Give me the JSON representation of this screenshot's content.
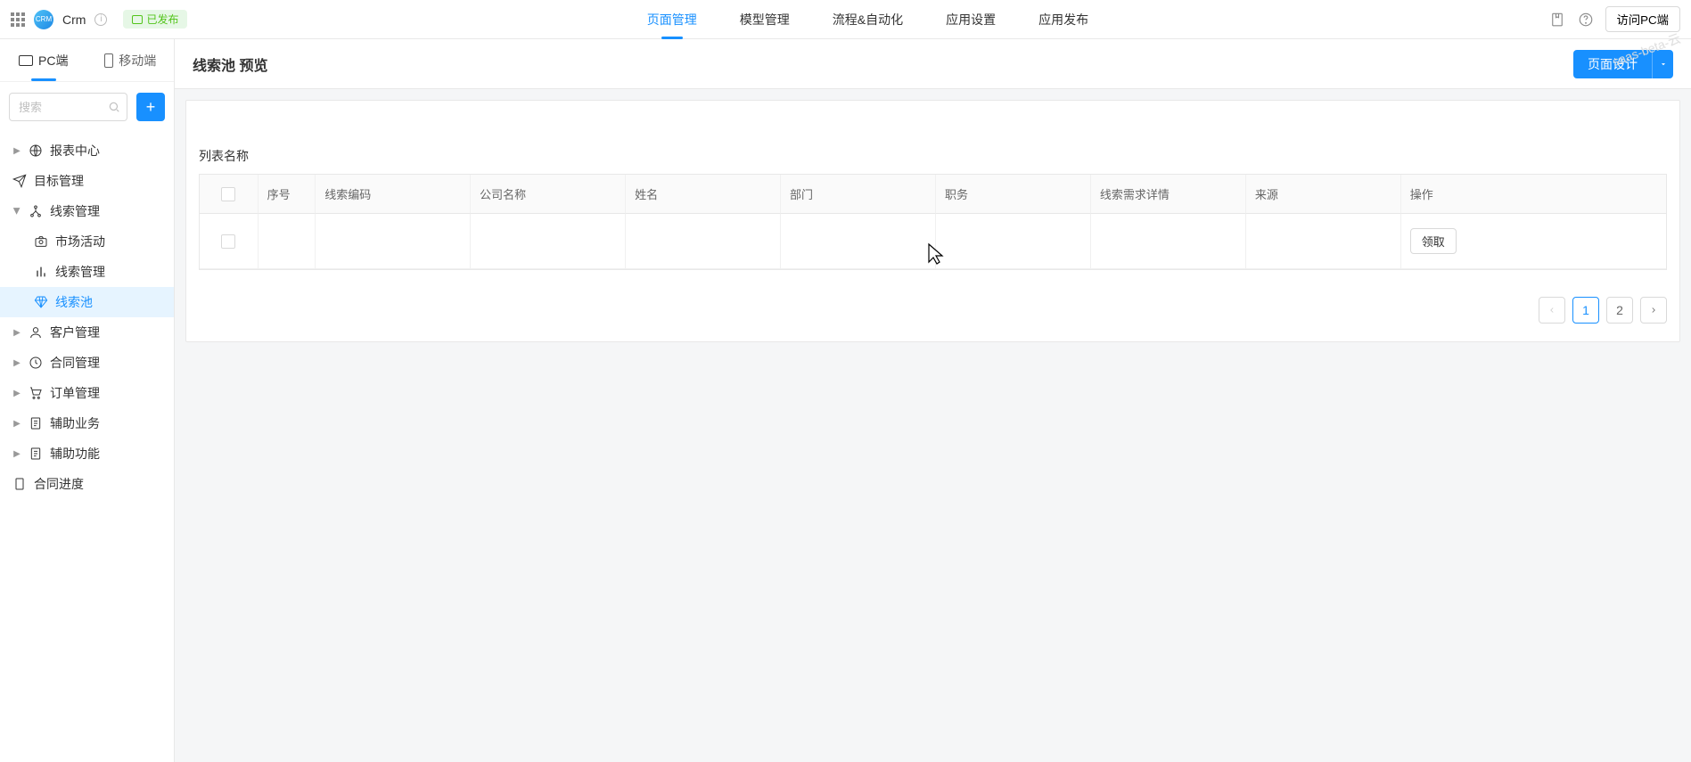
{
  "header": {
    "app_name": "Crm",
    "publish_status": "已发布",
    "nav": [
      {
        "label": "页面管理",
        "active": true
      },
      {
        "label": "模型管理",
        "active": false
      },
      {
        "label": "流程&自动化",
        "active": false
      },
      {
        "label": "应用设置",
        "active": false
      },
      {
        "label": "应用发布",
        "active": false
      }
    ],
    "visit_btn": "访问PC端"
  },
  "sidebar": {
    "device_tabs": {
      "pc": "PC端",
      "mobile": "移动端",
      "active": "pc"
    },
    "search_placeholder": "搜索",
    "tree": [
      {
        "label": "报表中心",
        "icon": "globe",
        "caret": true
      },
      {
        "label": "目标管理",
        "icon": "send",
        "caret": false,
        "no_caret_space": false
      },
      {
        "label": "线索管理",
        "icon": "nodes",
        "caret": true,
        "open": true,
        "children": [
          {
            "label": "市场活动",
            "icon": "camera"
          },
          {
            "label": "线索管理",
            "icon": "bars"
          },
          {
            "label": "线索池",
            "icon": "diamond",
            "selected": true
          }
        ]
      },
      {
        "label": "客户管理",
        "icon": "user",
        "caret": true
      },
      {
        "label": "合同管理",
        "icon": "clock",
        "caret": true
      },
      {
        "label": "订单管理",
        "icon": "cart",
        "caret": true
      },
      {
        "label": "辅助业务",
        "icon": "doc",
        "caret": true
      },
      {
        "label": "辅助功能",
        "icon": "doc",
        "caret": true
      },
      {
        "label": "合同进度",
        "icon": "page",
        "caret": false,
        "no_caret_space": false
      }
    ]
  },
  "main": {
    "title": "线索池 预览",
    "design_btn": "页面设计",
    "list_title": "列表名称",
    "columns": [
      "序号",
      "线索编码",
      "公司名称",
      "姓名",
      "部门",
      "职务",
      "线索需求详情",
      "来源",
      "操作"
    ],
    "row_action": "领取",
    "pagination": {
      "pages": [
        "1",
        "2"
      ],
      "current": "1"
    }
  },
  "watermark": "saas-beta-云"
}
